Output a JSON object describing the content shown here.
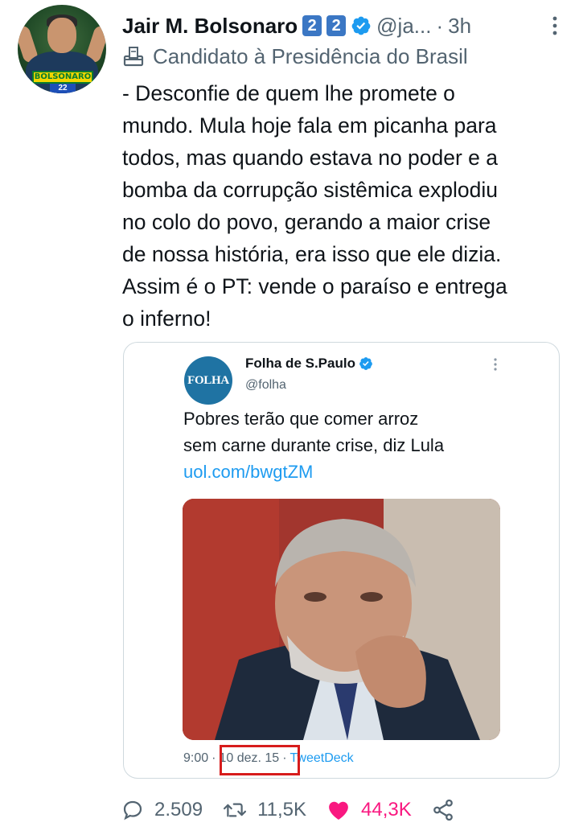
{
  "author": {
    "name": "Jair M. Bolsonaro",
    "name_emojis": [
      "2",
      "2"
    ],
    "handle": "@ja...",
    "separator": "·",
    "time": "3h",
    "role_label": "Candidato à Presidência do Brasil",
    "avatar_banner_text": "BOLSONARO",
    "avatar_number": "22"
  },
  "tweet": {
    "text": "- Desconfie de quem lhe promete o\nmundo. Mula hoje fala em picanha para\ntodos, mas quando estava no poder e a\nbomba da corrupção sistêmica explodiu\nno colo do povo, gerando a maior crise\nde nossa história, era isso que ele dizia.\nAssim é o PT: vende o paraíso e entrega\no inferno!"
  },
  "quote": {
    "avatar_text": "FOLHA",
    "name": "Folha de S.Paulo",
    "handle": "@folha",
    "text": "Pobres terão que comer arroz\nsem carne durante crise, diz Lula",
    "link": "uol.com/bwgtZM",
    "time": "9:00",
    "date": "10 dez. 15",
    "dot": "·",
    "source": "TweetDeck"
  },
  "actions": {
    "replies": "2.509",
    "retweets": "11,5K",
    "likes": "44,3K"
  },
  "colors": {
    "verified": "#1d9bf0",
    "like": "#f91880",
    "link": "#1d9bf0",
    "highlight_box": "#d71c1c",
    "folha_avatar": "#1f73a3"
  },
  "icons": [
    "verified-badge-icon",
    "ballot-box-icon",
    "more-options-icon",
    "reply-icon",
    "retweet-icon",
    "heart-icon",
    "share-icon"
  ]
}
